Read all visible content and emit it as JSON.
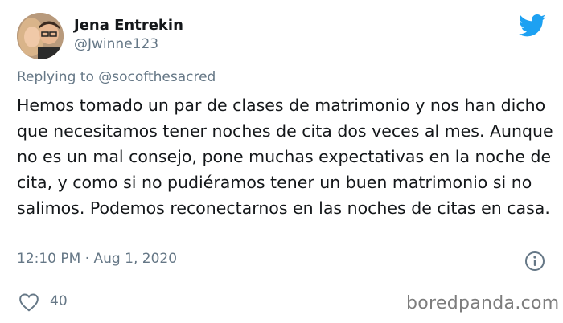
{
  "author": {
    "display_name": "Jena Entrekin",
    "handle": "@Jwinne123"
  },
  "reply": {
    "prefix": "Replying to ",
    "mention": "@socofthesacred"
  },
  "tweet": {
    "text": "Hemos tomado un par de clases de matrimonio y nos han dicho que necesitamos tener noches de cita dos veces al mes. Aunque no es un mal consejo, pone muchas expectativas en la noche de cita, y como si no pudiéramos tener un buen matrimonio si no salimos. Podemos reconectarnos en las noches de citas en casa.",
    "timestamp": "12:10 PM · Aug 1, 2020"
  },
  "engagement": {
    "likes": "40"
  },
  "watermark": "boredpanda.com",
  "colors": {
    "twitter_blue": "#1da1f2",
    "secondary_text": "#657786",
    "primary_text": "#14171a"
  },
  "icons": [
    "twitter-bird-icon",
    "info-icon",
    "heart-icon"
  ]
}
